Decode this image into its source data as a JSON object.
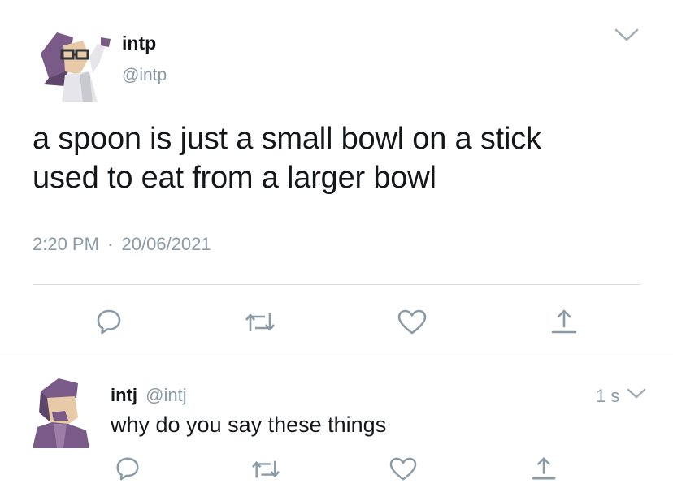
{
  "main_tweet": {
    "display_name": "intp",
    "handle": "@intp",
    "text_line1": "a spoon is just a small bowl on a stick",
    "text_line2": "used to eat from a larger bowl",
    "time": "2:20 PM",
    "separator": "·",
    "date": "20/06/2021"
  },
  "reply": {
    "display_name": "intj",
    "handle": "@intj",
    "age": "1 s",
    "text": "why do you say these things"
  },
  "colors": {
    "text": "#14171a",
    "secondary": "#8a9aa6",
    "divider": "#d8dde1"
  },
  "icons": [
    "chevron-down-icon",
    "reply-icon",
    "retweet-icon",
    "like-icon",
    "share-icon"
  ]
}
